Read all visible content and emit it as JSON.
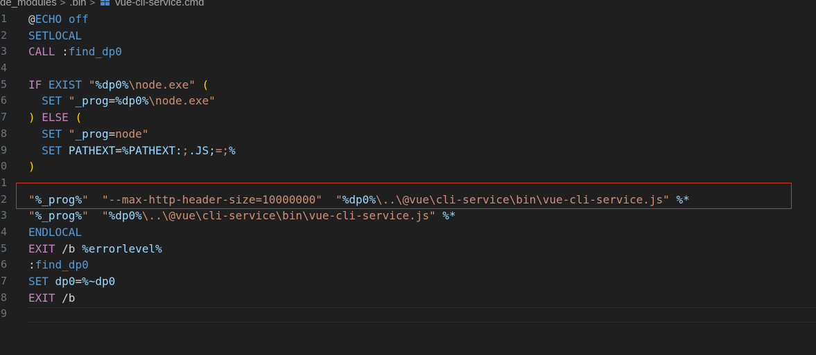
{
  "breadcrumb": {
    "segments": [
      "de_modules",
      ".bin",
      "vue-cli-service.cmd"
    ],
    "separator": ">",
    "file_icon": "windows-cmd-icon"
  },
  "editor": {
    "line_numbers": [
      "1",
      "2",
      "3",
      "4",
      "5",
      "6",
      "7",
      "8",
      "9",
      "0",
      "1",
      "2",
      "3",
      "4",
      "5",
      "6",
      "7",
      "8",
      "9"
    ],
    "lines": [
      [
        {
          "t": "@",
          "c": "plain"
        },
        {
          "t": "ECHO",
          "c": "kw"
        },
        {
          "t": " ",
          "c": "plain"
        },
        {
          "t": "off",
          "c": "kw"
        }
      ],
      [
        {
          "t": "SETLOCAL",
          "c": "kw"
        }
      ],
      [
        {
          "t": "CALL",
          "c": "ctl"
        },
        {
          "t": " :",
          "c": "plain"
        },
        {
          "t": "find_dp0",
          "c": "kw"
        }
      ],
      [],
      [
        {
          "t": "IF",
          "c": "ctl"
        },
        {
          "t": " ",
          "c": "plain"
        },
        {
          "t": "EXIST",
          "c": "kw"
        },
        {
          "t": " \"",
          "c": "str"
        },
        {
          "t": "%dp0%",
          "c": "var"
        },
        {
          "t": "\\node.exe\"",
          "c": "str"
        },
        {
          "t": " ",
          "c": "plain"
        },
        {
          "t": "(",
          "c": "paren"
        }
      ],
      [
        {
          "t": "  ",
          "c": "plain"
        },
        {
          "t": "SET",
          "c": "kw"
        },
        {
          "t": " \"",
          "c": "str"
        },
        {
          "t": "_prog",
          "c": "var"
        },
        {
          "t": "=",
          "c": "plain"
        },
        {
          "t": "%dp0%",
          "c": "var"
        },
        {
          "t": "\\node.exe\"",
          "c": "str"
        }
      ],
      [
        {
          "t": ")",
          "c": "paren"
        },
        {
          "t": " ",
          "c": "plain"
        },
        {
          "t": "ELSE",
          "c": "ctl"
        },
        {
          "t": " ",
          "c": "plain"
        },
        {
          "t": "(",
          "c": "paren"
        }
      ],
      [
        {
          "t": "  ",
          "c": "plain"
        },
        {
          "t": "SET",
          "c": "kw"
        },
        {
          "t": " \"",
          "c": "str"
        },
        {
          "t": "_prog",
          "c": "var"
        },
        {
          "t": "=",
          "c": "plain"
        },
        {
          "t": "node\"",
          "c": "str"
        }
      ],
      [
        {
          "t": "  ",
          "c": "plain"
        },
        {
          "t": "SET",
          "c": "kw"
        },
        {
          "t": " ",
          "c": "plain"
        },
        {
          "t": "PATHEXT",
          "c": "var"
        },
        {
          "t": "=",
          "c": "plain"
        },
        {
          "t": "%PATHEXT:",
          "c": "var"
        },
        {
          "t": ";",
          "c": "str"
        },
        {
          "t": ".JS;",
          "c": "var"
        },
        {
          "t": "=;",
          "c": "str"
        },
        {
          "t": "%",
          "c": "var"
        }
      ],
      [
        {
          "t": ")",
          "c": "paren"
        }
      ],
      [],
      [
        {
          "t": "\"",
          "c": "str"
        },
        {
          "t": "%_prog%",
          "c": "var"
        },
        {
          "t": "\"",
          "c": "str"
        },
        {
          "t": "  ",
          "c": "plain"
        },
        {
          "t": "\"--max-http-header-size=10000000\"",
          "c": "str"
        },
        {
          "t": "  \"",
          "c": "str"
        },
        {
          "t": "%dp0%",
          "c": "var"
        },
        {
          "t": "\\..\\@vue\\cli-service\\bin\\vue-cli-service.js\"",
          "c": "str"
        },
        {
          "t": " ",
          "c": "plain"
        },
        {
          "t": "%*",
          "c": "var"
        }
      ],
      [
        {
          "t": "\"",
          "c": "str"
        },
        {
          "t": "%_prog%",
          "c": "var"
        },
        {
          "t": "\"",
          "c": "str"
        },
        {
          "t": "  \"",
          "c": "str"
        },
        {
          "t": "%dp0%",
          "c": "var"
        },
        {
          "t": "\\..\\@vue\\cli-service\\bin\\vue-cli-service.js\"",
          "c": "str"
        },
        {
          "t": " ",
          "c": "plain"
        },
        {
          "t": "%*",
          "c": "var"
        }
      ],
      [
        {
          "t": "ENDLOCAL",
          "c": "kw"
        }
      ],
      [
        {
          "t": "EXIT",
          "c": "ctl"
        },
        {
          "t": " /b ",
          "c": "plain"
        },
        {
          "t": "%errorlevel%",
          "c": "var"
        }
      ],
      [
        {
          "t": ":",
          "c": "plain"
        },
        {
          "t": "find_dp0",
          "c": "kw"
        }
      ],
      [
        {
          "t": "SET",
          "c": "kw"
        },
        {
          "t": " ",
          "c": "plain"
        },
        {
          "t": "dp0",
          "c": "var"
        },
        {
          "t": "=",
          "c": "plain"
        },
        {
          "t": "%~dp0",
          "c": "var"
        }
      ],
      [
        {
          "t": "EXIT",
          "c": "ctl"
        },
        {
          "t": " /b",
          "c": "plain"
        }
      ],
      []
    ]
  },
  "annotation": {
    "highlight_color": "#d1322f",
    "highlighted_line": "12"
  },
  "theme": {
    "background": "#1f1f1f",
    "keyword": "#569cd6",
    "control": "#c586c0",
    "string": "#ce9178",
    "variable": "#9cdcfe",
    "bracket": "#ffd700",
    "line_number": "#6e7681"
  }
}
